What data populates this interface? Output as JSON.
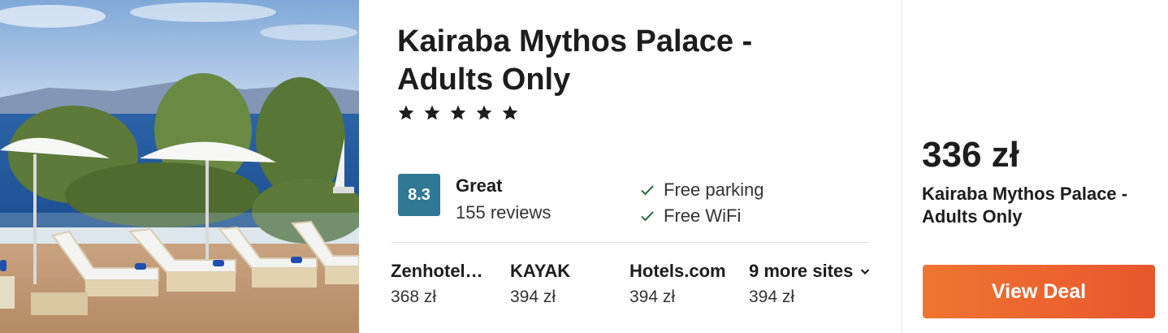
{
  "hotel": {
    "name": "Kairaba Mythos Palace - Adults Only",
    "star_rating": 5,
    "stars_icon": "star-icon"
  },
  "rating": {
    "score": "8.3",
    "label": "Great",
    "reviews": "155 reviews",
    "badge_color": "#2f7994"
  },
  "amenities": [
    {
      "label": "Free parking",
      "icon": "check-icon"
    },
    {
      "label": "Free WiFi",
      "icon": "check-icon"
    }
  ],
  "sites": [
    {
      "name": "Zenhotel…",
      "price": "368 zł"
    },
    {
      "name": "KAYAK",
      "price": "394 zł"
    },
    {
      "name": "Hotels.com",
      "price": "394 zł"
    }
  ],
  "more_sites": {
    "label": "9 more sites",
    "price": "394 zł",
    "icon": "chevron-down-icon"
  },
  "deal": {
    "price": "336 zł",
    "provider": "Kairaba Mythos Palace - Adults Only",
    "button_label": "View Deal",
    "button_color_start": "#ef7532",
    "button_color_end": "#e8562c"
  }
}
